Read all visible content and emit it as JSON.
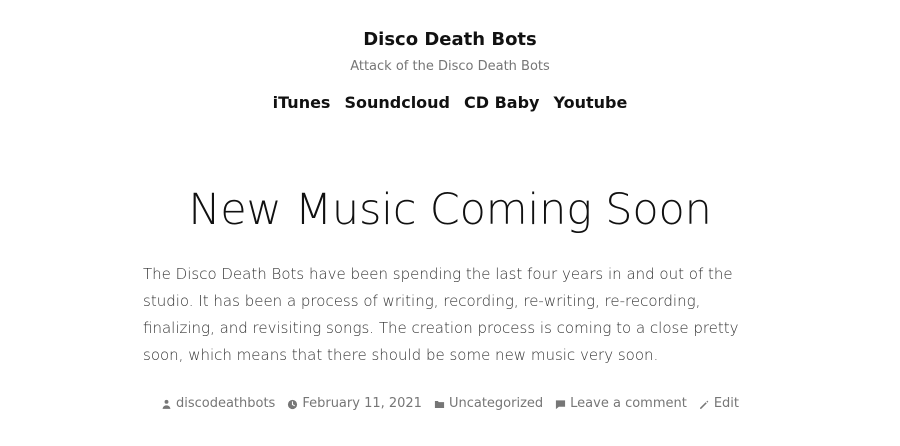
{
  "site": {
    "title": "Disco Death Bots",
    "tagline": "Attack of the Disco Death Bots"
  },
  "nav": {
    "items": [
      {
        "label": "iTunes"
      },
      {
        "label": "Soundcloud"
      },
      {
        "label": "CD Baby"
      },
      {
        "label": "Youtube"
      }
    ]
  },
  "post": {
    "title": "New Music Coming Soon",
    "body": "The Disco Death Bots have been spending the last four years in and out of the studio. It has been a process of writing, recording, re-writing, re-recording, finalizing, and revisiting songs. The creation process is coming to a close pretty soon, which means that there should be some new music very soon."
  },
  "meta": {
    "author": "discodeathbots",
    "date": "February 11, 2021",
    "category": "Uncategorized",
    "comment": "Leave a comment",
    "edit": "Edit"
  },
  "icons": {
    "author": "person-icon",
    "date": "clock-icon",
    "category": "folder-icon",
    "comment": "comment-icon",
    "edit": "pencil-icon"
  },
  "colors": {
    "text": "#111111",
    "muted": "#767676",
    "body": "#333333",
    "background": "#ffffff"
  }
}
